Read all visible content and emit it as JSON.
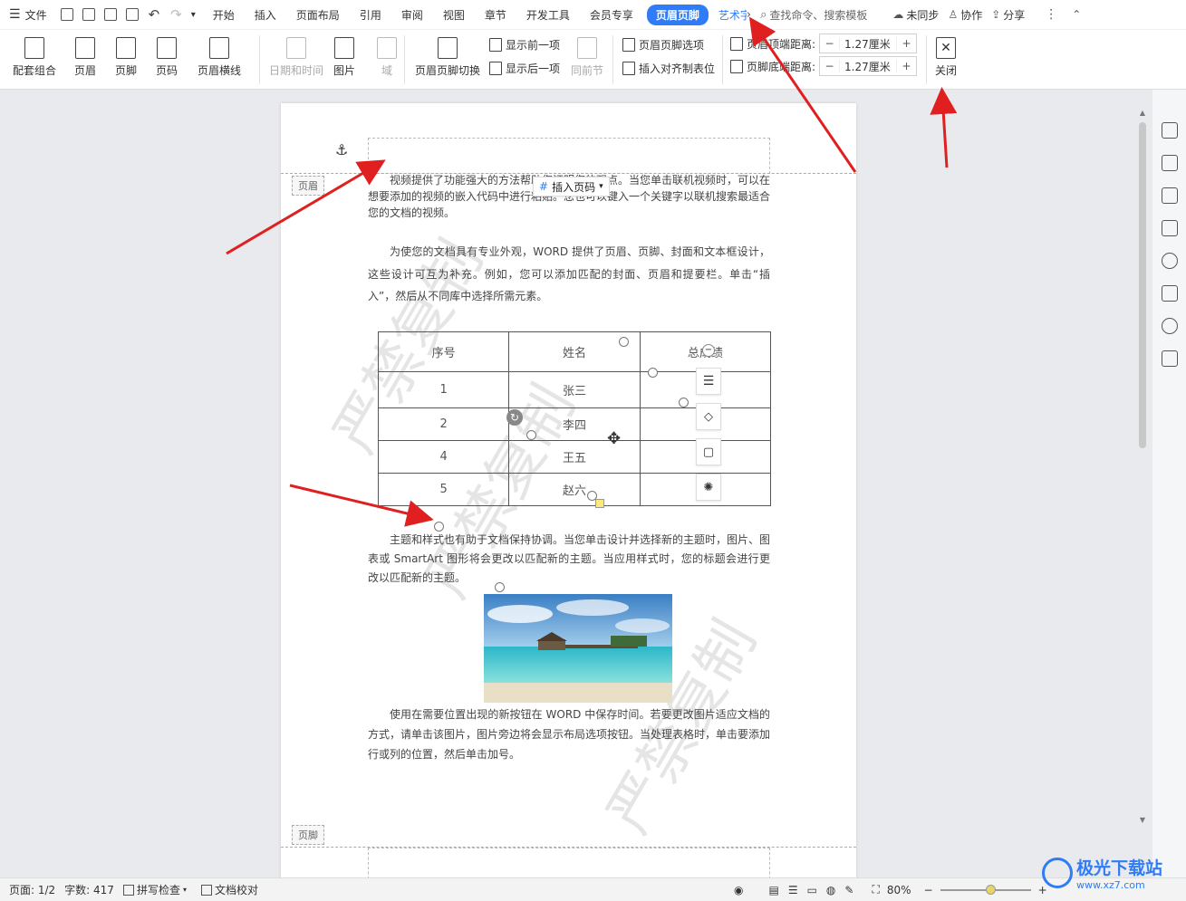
{
  "menubar": {
    "file_label": "文件",
    "tabs": [
      "开始",
      "插入",
      "页面布局",
      "引用",
      "审阅",
      "视图",
      "章节",
      "开发工具",
      "会员专享"
    ],
    "active_tab": "页眉页脚",
    "art_tab": "艺术字",
    "search_placeholder": "查找命令、搜索模板",
    "sync_label": "未同步",
    "collab_label": "协作",
    "share_label": "分享"
  },
  "ribbon": {
    "combo": "配套组合",
    "header": "页眉",
    "footer": "页脚",
    "page_num": "页码",
    "header_line": "页眉横线",
    "datetime": "日期和时间",
    "picture": "图片",
    "field": "域",
    "switch": "页眉页脚切换",
    "show_prev": "显示前一项",
    "show_next": "显示后一项",
    "same_prev": "同前节",
    "hf_options": "页眉页脚选项",
    "insert_align_tab": "插入对齐制表位",
    "top_dist_label": "页眉顶端距离:",
    "top_dist_value": "1.27厘米",
    "bottom_dist_label": "页脚底端距离:",
    "bottom_dist_value": "1.27厘米",
    "close": "关闭",
    "minus": "−",
    "plus": "+"
  },
  "document": {
    "header_tag": "页眉",
    "footer_tag": "页脚",
    "insert_page_num": "插入页码",
    "watermark": "严禁复制",
    "para1": "视频提供了功能强大的方法帮助您证明您的观点。当您单击联机视频时，可以在想要添加的视频的嵌入代码中进行粘贴。您也可以键入一个关键字以联机搜索最适合您的文档的视频。",
    "para2": "为使您的文档具有专业外观，WORD 提供了页眉、页脚、封面和文本框设计，这些设计可互为补充。例如，您可以添加匹配的封面、页眉和提要栏。单击“插入”，然后从不同库中选择所需元素。",
    "para3": "主题和样式也有助于文档保持协调。当您单击设计并选择新的主题时，图片、图表或 SmartArt 图形将会更改以匹配新的主题。当应用样式时，您的标题会进行更改以匹配新的主题。",
    "para4": "使用在需要位置出现的新按钮在 WORD 中保存时间。若要更改图片适应文档的方式，请单击该图片，图片旁边将会显示布局选项按钮。当处理表格时，单击要添加行或列的位置，然后单击加号。",
    "table": {
      "headers": [
        "序号",
        "姓名",
        "总成绩"
      ],
      "rows": [
        [
          "1",
          "张三",
          ""
        ],
        [
          "2",
          "李四",
          ""
        ],
        [
          "4",
          "王五",
          ""
        ],
        [
          "5",
          "赵六",
          ""
        ]
      ]
    }
  },
  "statusbar": {
    "page": "页面: 1/2",
    "words": "字数: 417",
    "spell": "拼写检查",
    "proof": "文档校对",
    "zoom": "80%"
  },
  "watermark_site": "极光下载站",
  "watermark_url": "www.xz7.com",
  "colors": {
    "accent": "#2f7cf6",
    "arrow": "#e02020"
  }
}
